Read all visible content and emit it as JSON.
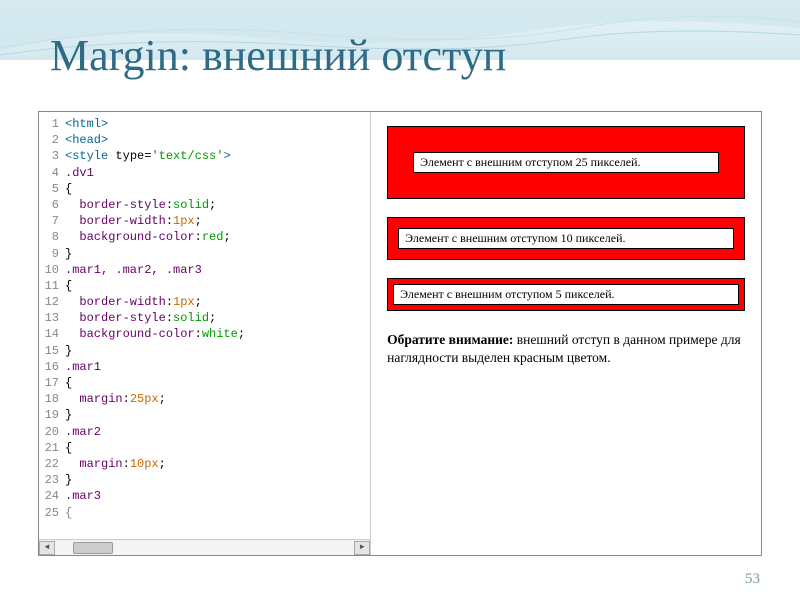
{
  "title": "Margin: внешний отступ",
  "page_number": "53",
  "code": {
    "lines": [
      {
        "n": "1",
        "html": "<html>",
        "cls": "tag"
      },
      {
        "n": "2",
        "html": "<head>",
        "cls": "tag"
      },
      {
        "n": "3",
        "html_parts": [
          {
            "t": "<style",
            "c": "tag"
          },
          {
            "t": " type=",
            "c": "attr"
          },
          {
            "t": "'text/css'",
            "c": "string"
          },
          {
            "t": ">",
            "c": "tag"
          }
        ]
      },
      {
        "n": "4",
        "html": ".dv1",
        "cls": "selector"
      },
      {
        "n": "5",
        "html": "{",
        "cls": ""
      },
      {
        "n": "6",
        "html_parts": [
          {
            "t": "  border-style",
            "c": "property"
          },
          {
            "t": ":",
            "c": ""
          },
          {
            "t": "solid",
            "c": "value"
          },
          {
            "t": ";",
            "c": ""
          }
        ]
      },
      {
        "n": "7",
        "html_parts": [
          {
            "t": "  border-width",
            "c": "property"
          },
          {
            "t": ":",
            "c": ""
          },
          {
            "t": "1px",
            "c": "number"
          },
          {
            "t": ";",
            "c": ""
          }
        ]
      },
      {
        "n": "8",
        "html_parts": [
          {
            "t": "  background-color",
            "c": "property"
          },
          {
            "t": ":",
            "c": ""
          },
          {
            "t": "red",
            "c": "value"
          },
          {
            "t": ";",
            "c": ""
          }
        ]
      },
      {
        "n": "9",
        "html": "}",
        "cls": ""
      },
      {
        "n": "10",
        "html": ".mar1, .mar2, .mar3",
        "cls": "selector"
      },
      {
        "n": "11",
        "html": "{",
        "cls": ""
      },
      {
        "n": "12",
        "html_parts": [
          {
            "t": "  border-width",
            "c": "property"
          },
          {
            "t": ":",
            "c": ""
          },
          {
            "t": "1px",
            "c": "number"
          },
          {
            "t": ";",
            "c": ""
          }
        ]
      },
      {
        "n": "13",
        "html_parts": [
          {
            "t": "  border-style",
            "c": "property"
          },
          {
            "t": ":",
            "c": ""
          },
          {
            "t": "solid",
            "c": "value"
          },
          {
            "t": ";",
            "c": ""
          }
        ]
      },
      {
        "n": "14",
        "html_parts": [
          {
            "t": "  background-color",
            "c": "property"
          },
          {
            "t": ":",
            "c": ""
          },
          {
            "t": "white",
            "c": "value"
          },
          {
            "t": ";",
            "c": ""
          }
        ]
      },
      {
        "n": "15",
        "html": "}",
        "cls": ""
      },
      {
        "n": "16",
        "html": ".mar1",
        "cls": "selector"
      },
      {
        "n": "17",
        "html": "{",
        "cls": ""
      },
      {
        "n": "18",
        "html_parts": [
          {
            "t": "  margin",
            "c": "property"
          },
          {
            "t": ":",
            "c": ""
          },
          {
            "t": "25px",
            "c": "number"
          },
          {
            "t": ";",
            "c": ""
          }
        ]
      },
      {
        "n": "19",
        "html": "}",
        "cls": ""
      },
      {
        "n": "20",
        "html": ".mar2",
        "cls": "selector"
      },
      {
        "n": "21",
        "html": "{",
        "cls": ""
      },
      {
        "n": "22",
        "html_parts": [
          {
            "t": "  margin",
            "c": "property"
          },
          {
            "t": ":",
            "c": ""
          },
          {
            "t": "10px",
            "c": "number"
          },
          {
            "t": ";",
            "c": ""
          }
        ]
      },
      {
        "n": "23",
        "html": "}",
        "cls": ""
      },
      {
        "n": "24",
        "html": ".mar3",
        "cls": "selector"
      },
      {
        "n": "25",
        "html": "{",
        "cls": "dim"
      }
    ]
  },
  "preview": {
    "box1": "Элемент с внешним отступом 25 пикселей.",
    "box2": "Элемент с внешним отступом 10 пикселей.",
    "box3": "Элемент с внешним отступом 5 пикселей.",
    "note_bold": "Обратите внимание:",
    "note_rest": " внешний отступ в данном примере для наглядности выделен красным цветом."
  }
}
